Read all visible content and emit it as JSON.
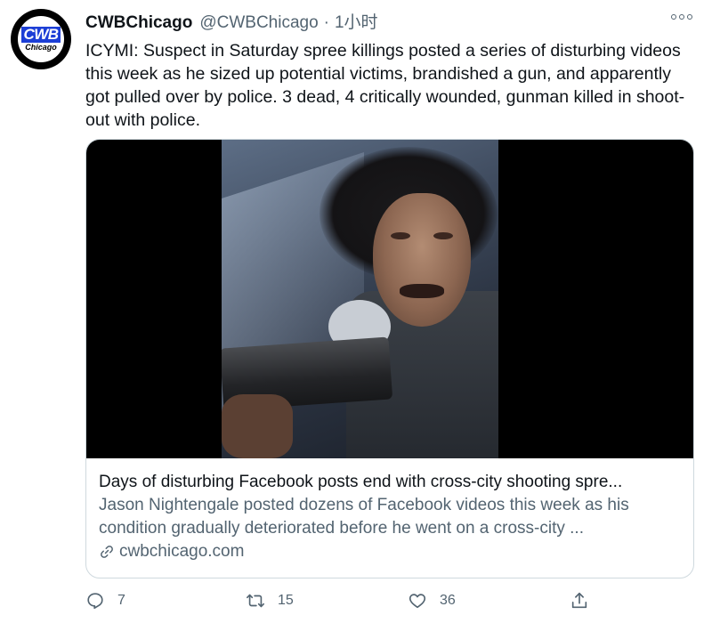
{
  "tweet": {
    "avatar": {
      "line1": "CWB",
      "line2": "Chicago",
      "brand_color": "#1d3fd6"
    },
    "display_name": "CWBChicago",
    "handle": "@CWBChicago",
    "separator": "·",
    "time": "1小时",
    "text": "ICYMI: Suspect in Saturday spree killings posted a series of disturbing videos this week as he sized up potential victims, brandished a gun, and apparently got pulled over by police.  3 dead, 4 critically wounded, gunman killed in shoot-out with police."
  },
  "card": {
    "title": "Days of disturbing Facebook posts end with cross-city shooting spre...",
    "description": "Jason Nightengale posted dozens of Facebook videos this week as his condition gradually deteriorated before he went on a cross-city ...",
    "domain": "cwbchicago.com"
  },
  "actions": {
    "reply_count": "7",
    "retweet_count": "15",
    "like_count": "36"
  },
  "colors": {
    "text": "#0f1419",
    "secondary": "#536471",
    "border": "#cfd9de"
  }
}
